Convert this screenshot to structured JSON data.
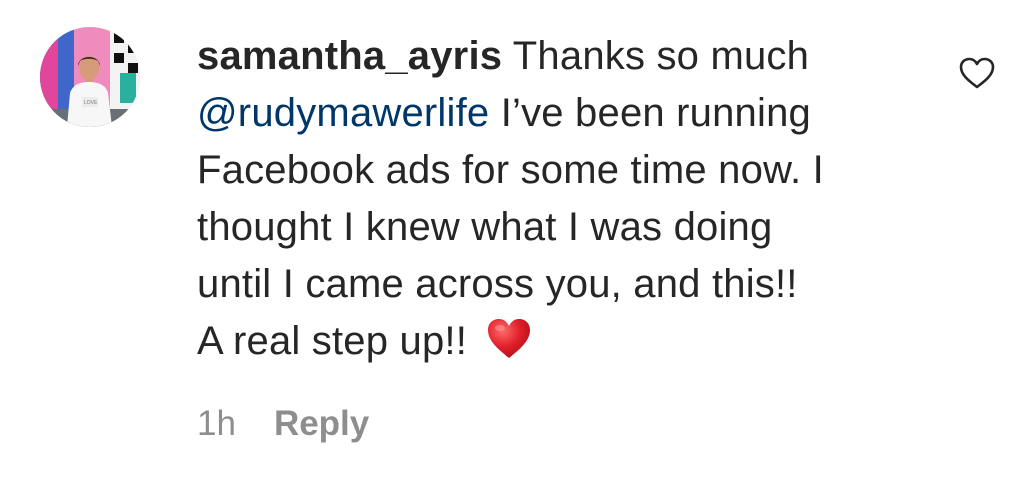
{
  "comment": {
    "username": "samantha_ayris",
    "segments": {
      "first": " Thanks so much\n",
      "mention": "@rudymawerlife",
      "rest": " I’ve been running\nFacebook ads for some time now. I\nthought I knew what I was doing\nuntil I came across you, and this!!\nA real step up!! "
    },
    "emoji": "red-heart-emoji",
    "time": "1h",
    "reply_label": "Reply"
  },
  "icons": {
    "like": "heart-outline-icon"
  },
  "colors": {
    "text": "#262626",
    "mention": "#00376b",
    "secondary": "#8e8e8e",
    "heart_emoji": "#e0202a",
    "background": "#ffffff"
  }
}
